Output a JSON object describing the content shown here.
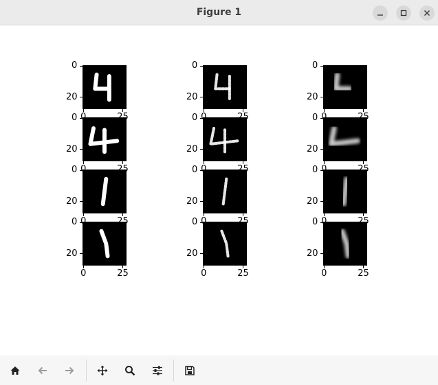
{
  "window": {
    "title": "Figure 1"
  },
  "figure": {
    "y_tick_labels": [
      "0",
      "20"
    ],
    "x_tick_labels": [
      "0",
      "25"
    ]
  },
  "grid": {
    "rows": 4,
    "columns": 3,
    "images": [
      [
        "digit 4 (original)",
        "digit 4 (noisy)",
        "digit 4 (reconstructed)"
      ],
      [
        "digit 4 (original)",
        "digit 4 (noisy)",
        "digit 4 (reconstructed)"
      ],
      [
        "digit 1 (original)",
        "digit 1 (noisy)",
        "digit 1 (reconstructed)"
      ],
      [
        "digit 1 (original)",
        "digit 1 (noisy)",
        "digit 1 (reconstructed)"
      ]
    ]
  },
  "toolbar": {
    "buttons": [
      "home-icon",
      "back-icon",
      "forward-icon",
      "pan-icon",
      "zoom-icon",
      "configure-icon",
      "save-icon"
    ]
  },
  "colors": {
    "image_bg": "#000000",
    "toolbar_bg": "#f6f6f6",
    "titlebar_bg": "#ebebeb"
  }
}
